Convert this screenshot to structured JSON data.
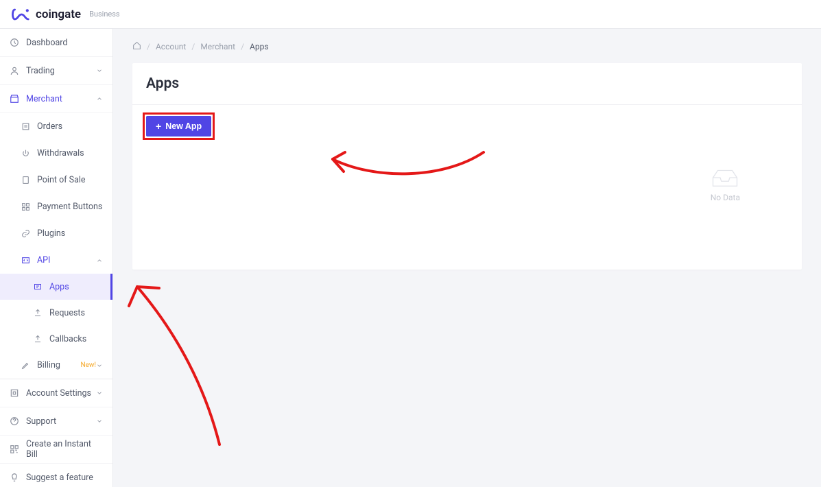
{
  "header": {
    "brand": "coingate",
    "brand_sub": "Business"
  },
  "sidebar": {
    "dashboard": "Dashboard",
    "trading": "Trading",
    "merchant": "Merchant",
    "merchant_items": {
      "orders": "Orders",
      "withdrawals": "Withdrawals",
      "pos": "Point of Sale",
      "payment_buttons": "Payment Buttons",
      "plugins": "Plugins",
      "api": "API",
      "api_items": {
        "apps": "Apps",
        "requests": "Requests",
        "callbacks": "Callbacks"
      },
      "billing": "Billing",
      "billing_badge": "New!"
    },
    "account_settings": "Account Settings",
    "support": "Support",
    "instant_bill": "Create an Instant Bill",
    "suggest": "Suggest a feature"
  },
  "breadcrumb": {
    "account": "Account",
    "merchant": "Merchant",
    "apps": "Apps"
  },
  "panel": {
    "title": "Apps",
    "new_app_label": "New App"
  },
  "empty": {
    "no_data": "No Data"
  }
}
